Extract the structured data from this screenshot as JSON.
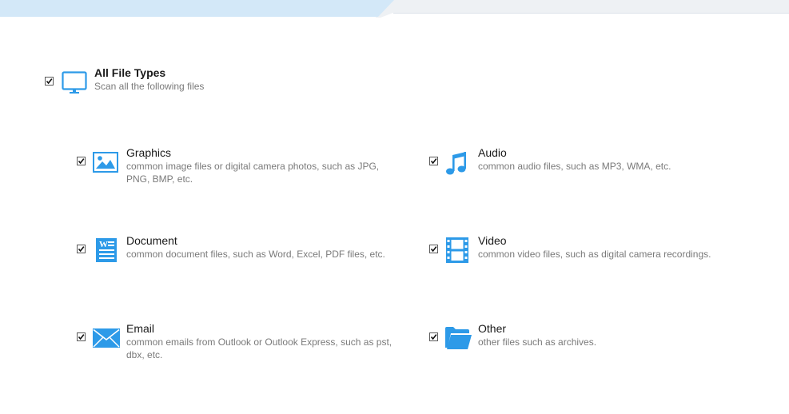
{
  "all": {
    "title": "All File Types",
    "desc": "Scan all the following files",
    "checked": true,
    "icon": "monitor-icon"
  },
  "types": {
    "graphics": {
      "title": "Graphics",
      "desc": "common image files or digital camera photos, such as JPG, PNG, BMP, etc.",
      "checked": true,
      "icon": "image-icon"
    },
    "audio": {
      "title": "Audio",
      "desc": "common audio files, such as MP3, WMA, etc.",
      "checked": true,
      "icon": "music-note-icon"
    },
    "document": {
      "title": "Document",
      "desc": "common document files, such as Word, Excel, PDF files, etc.",
      "checked": true,
      "icon": "document-icon"
    },
    "video": {
      "title": "Video",
      "desc": "common video files, such as digital camera recordings.",
      "checked": true,
      "icon": "film-icon"
    },
    "email": {
      "title": "Email",
      "desc": "common emails from Outlook or Outlook Express, such as pst, dbx, etc.",
      "checked": true,
      "icon": "envelope-icon"
    },
    "other": {
      "title": "Other",
      "desc": "other files such as archives.",
      "checked": true,
      "icon": "folder-icon"
    }
  },
  "colors": {
    "accent": "#2d9ae8",
    "tab_active": "#d3e8f8",
    "tab_inactive": "#eef1f4"
  }
}
